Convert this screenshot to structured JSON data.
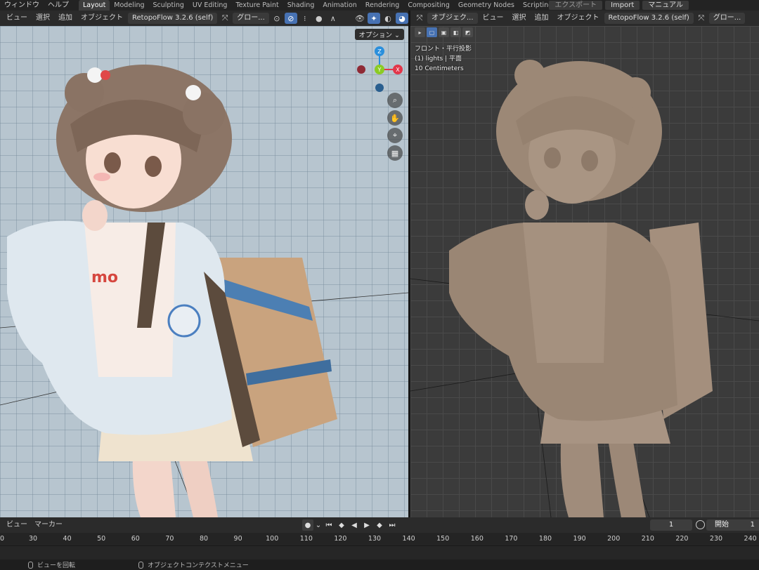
{
  "topbar": {
    "menus": [
      "ウィンドウ",
      "ヘルプ"
    ],
    "workspaces": [
      "Layout",
      "Modeling",
      "Sculpting",
      "UV Editing",
      "Texture Paint",
      "Shading",
      "Animation",
      "Rendering",
      "Compositing",
      "Geometry Nodes",
      "Scripting"
    ],
    "active_workspace": "Layout",
    "plus": "+",
    "export_label": "エクスポート",
    "import_label": "Import",
    "manual_label": "マニュアル"
  },
  "left_header": {
    "view": "ビュー",
    "select": "選択",
    "add": "追加",
    "object": "オブジェクト",
    "retopo": "RetopoFlow 3.2.6 (self)",
    "transform": "グロー..."
  },
  "right_header": {
    "mode": "オブジェク...",
    "view": "ビュー",
    "select": "選択",
    "add": "追加",
    "object": "オブジェクト",
    "retopo": "RetopoFlow 3.2.6 (self)",
    "transform": "グロー..."
  },
  "left_viewport": {
    "options": "オプション",
    "gizmo": {
      "z": "Z",
      "y": "Y",
      "x": "X"
    },
    "colors": {
      "x": "#e2364a",
      "y": "#8bcb23",
      "z": "#2a8fdc"
    }
  },
  "right_viewport": {
    "view_name": "フロント・平行投影",
    "collection": "(1) lights | 平面",
    "scale": "10 Centimeters"
  },
  "timeline": {
    "view": "ビュー",
    "marker": "マーカー",
    "current_frame": "1",
    "start_label": "開始",
    "start_value": "1",
    "ticks": [
      "0",
      "30",
      "40",
      "50",
      "60",
      "70",
      "80",
      "90",
      "100",
      "110",
      "120",
      "130",
      "140",
      "150",
      "160",
      "170",
      "180",
      "190",
      "200",
      "210",
      "220",
      "230",
      "240"
    ]
  },
  "statusbar": {
    "rotate_view": "ビューを回転",
    "context_menu": "オブジェクトコンテクストメニュー"
  }
}
